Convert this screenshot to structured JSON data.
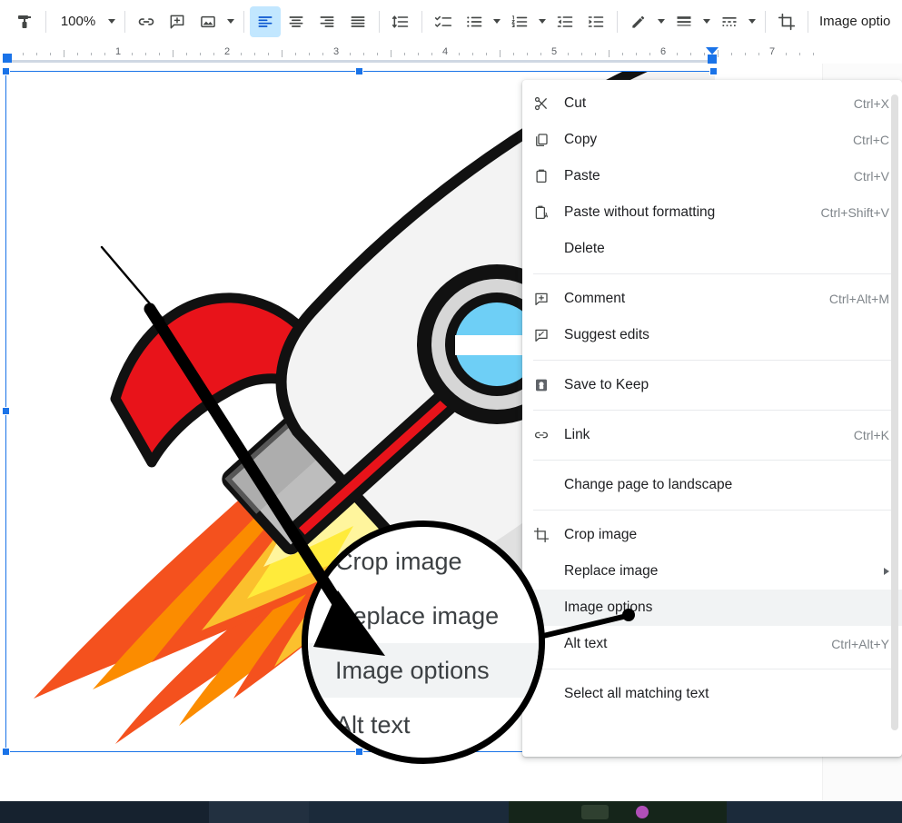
{
  "toolbar": {
    "paint_format_icon": "paint-roller-icon",
    "zoom_value": "100%",
    "zoom_caret_icon": "chevron-down-icon",
    "link_icon": "link-icon",
    "comment_icon": "add-comment-icon",
    "image_icon": "insert-image-icon",
    "image_caret_icon": "chevron-down-icon",
    "align_left_icon": "align-left-icon",
    "align_center_icon": "align-center-icon",
    "align_right_icon": "align-right-icon",
    "align_justify_icon": "align-justify-icon",
    "line_spacing_icon": "line-spacing-icon",
    "checklist_icon": "checklist-icon",
    "bulleted_list_icon": "bulleted-list-icon",
    "bulleted_caret_icon": "chevron-down-icon",
    "numbered_list_icon": "numbered-list-icon",
    "numbered_caret_icon": "chevron-down-icon",
    "decrease_indent_icon": "decrease-indent-icon",
    "increase_indent_icon": "increase-indent-icon",
    "pencil_icon": "pencil-icon",
    "pencil_caret_icon": "chevron-down-icon",
    "border_weight_icon": "border-weight-icon",
    "border_weight_caret_icon": "chevron-down-icon",
    "border_dash_icon": "border-dash-icon",
    "border_dash_caret_icon": "chevron-down-icon",
    "crop_icon": "crop-icon",
    "image_options_label": "Image optio"
  },
  "ruler": {
    "numbers": [
      "1",
      "2",
      "3",
      "4",
      "5",
      "6",
      "7"
    ],
    "left_indent_marker": "left-indent-marker",
    "right_indent_marker": "right-indent-marker"
  },
  "context_menu": {
    "items": [
      {
        "label": "Cut",
        "accel": "Ctrl+X",
        "icon": "scissors-icon",
        "highlighted": false,
        "submenu": false
      },
      {
        "label": "Copy",
        "accel": "Ctrl+C",
        "icon": "copy-icon",
        "highlighted": false,
        "submenu": false
      },
      {
        "label": "Paste",
        "accel": "Ctrl+V",
        "icon": "clipboard-icon",
        "highlighted": false,
        "submenu": false
      },
      {
        "label": "Paste without formatting",
        "accel": "Ctrl+Shift+V",
        "icon": "paste-plain-icon",
        "highlighted": false,
        "submenu": false
      },
      {
        "label": "Delete",
        "accel": "",
        "icon": "",
        "highlighted": false,
        "submenu": false
      },
      {
        "label": "Comment",
        "accel": "Ctrl+Alt+M",
        "icon": "add-comment-icon",
        "highlighted": false,
        "submenu": false
      },
      {
        "label": "Suggest edits",
        "accel": "",
        "icon": "suggest-edits-icon",
        "highlighted": false,
        "submenu": false
      },
      {
        "label": "Save to Keep",
        "accel": "",
        "icon": "keep-icon",
        "highlighted": false,
        "submenu": false
      },
      {
        "label": "Link",
        "accel": "Ctrl+K",
        "icon": "link-icon",
        "highlighted": false,
        "submenu": false
      },
      {
        "label": "Change page to landscape",
        "accel": "",
        "icon": "",
        "highlighted": false,
        "submenu": false
      },
      {
        "label": "Crop image",
        "accel": "",
        "icon": "crop-icon",
        "highlighted": false,
        "submenu": false
      },
      {
        "label": "Replace image",
        "accel": "",
        "icon": "",
        "highlighted": false,
        "submenu": true
      },
      {
        "label": "Image options",
        "accel": "",
        "icon": "",
        "highlighted": true,
        "submenu": false
      },
      {
        "label": "Alt text",
        "accel": "Ctrl+Alt+Y",
        "icon": "",
        "highlighted": false,
        "submenu": false
      },
      {
        "label": "Select all matching text",
        "accel": "",
        "icon": "",
        "highlighted": false,
        "submenu": false
      }
    ],
    "scrollbar": "menu-scrollbar"
  },
  "magnifier": {
    "rows": [
      {
        "label": "Crop image",
        "highlighted": false
      },
      {
        "label": "Replace image",
        "highlighted": false
      },
      {
        "label": "Image options",
        "highlighted": true
      },
      {
        "label": "Alt text",
        "highlighted": false
      }
    ]
  },
  "annotation": {
    "arrow": "hand-drawn-arrow",
    "callout_line": "callout-leader-line",
    "circle": "magnifier-circle"
  },
  "document": {
    "image_alt": "rocket-clipart-image"
  },
  "colors": {
    "accent_blue": "#1a73e8",
    "toolbar_active_bg": "#c2e7ff",
    "menu_highlight": "#f1f3f4",
    "rocket_red": "#e8131a",
    "rocket_body": "#f1f1f1",
    "flame_orange": "#f4511e",
    "flame_yellow": "#ffeb3b",
    "porthole_blue": "#6ecff6",
    "taskbar": "#1b2a3a"
  }
}
